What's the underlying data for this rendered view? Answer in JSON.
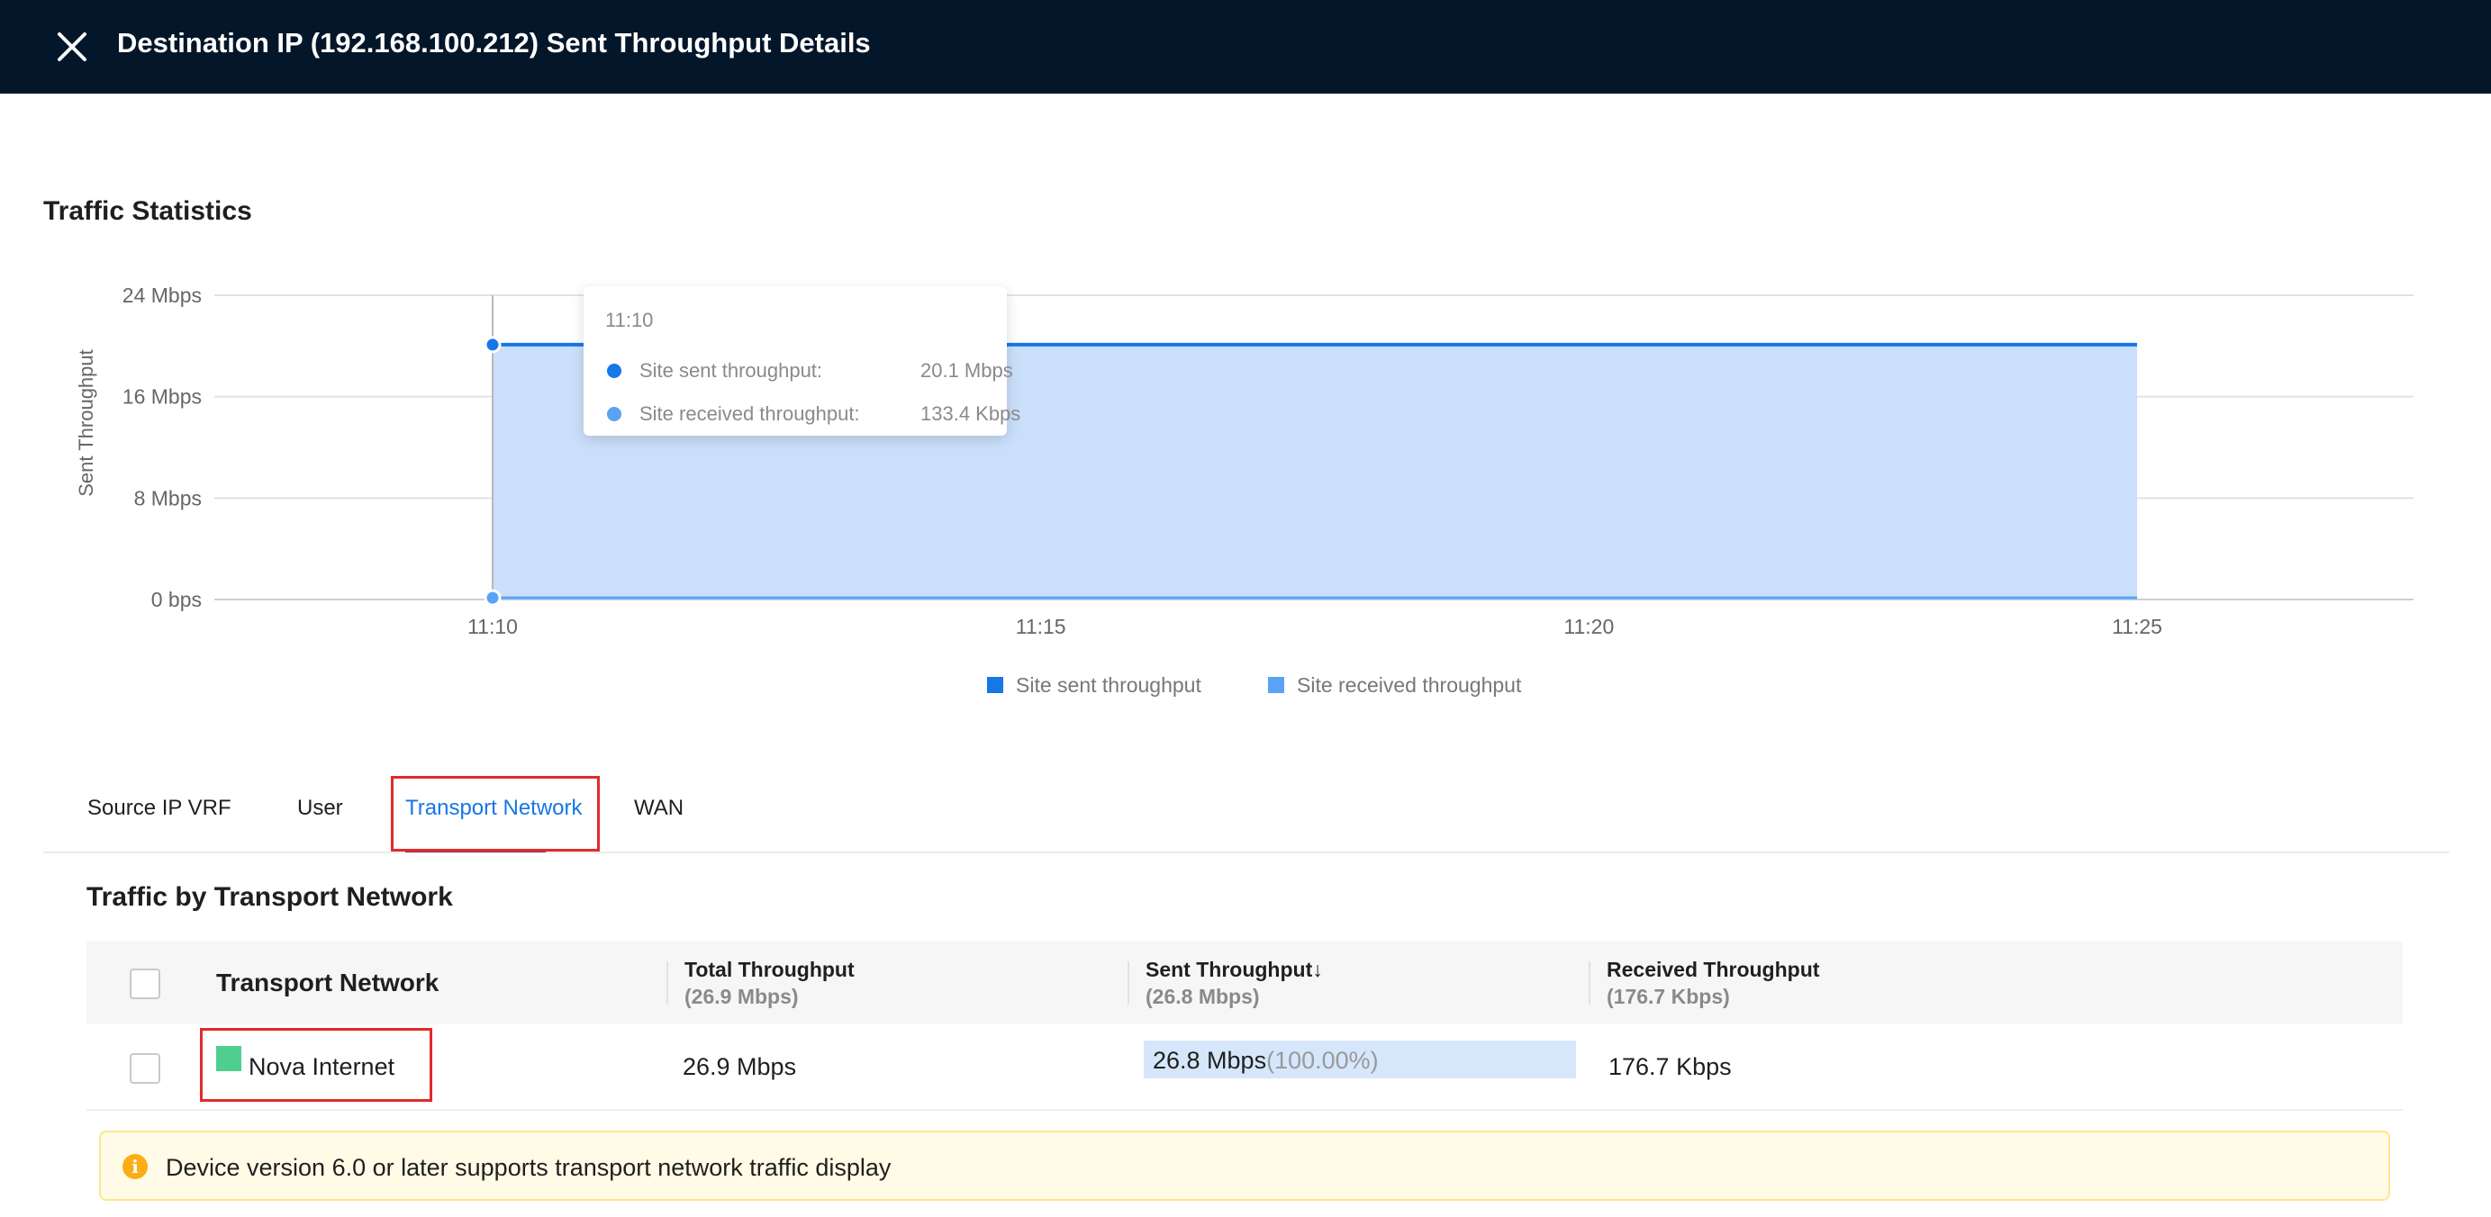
{
  "header": {
    "title": "Destination IP (192.168.100.212) Sent Throughput Details",
    "close_icon": "close-icon"
  },
  "section_title": "Traffic Statistics",
  "chart_data": {
    "type": "area",
    "title": "",
    "xlabel": "",
    "ylabel": "Sent Throughput",
    "x": [
      "11:10",
      "11:25"
    ],
    "x_ticks": [
      "11:10",
      "11:15",
      "11:20",
      "11:25"
    ],
    "y_ticks": [
      "0 bps",
      "8 Mbps",
      "16 Mbps",
      "24 Mbps"
    ],
    "ylim": [
      0,
      24
    ],
    "y_unit": "Mbps",
    "grid": true,
    "legend_position": "bottom-center",
    "series": [
      {
        "name": "Site sent throughput",
        "values": [
          20.1,
          20.1
        ],
        "color": "#1677e6"
      },
      {
        "name": "Site received throughput",
        "values": [
          0.1334,
          0.1334
        ],
        "color": "#59a3f5"
      }
    ]
  },
  "tooltip": {
    "time": "11:10",
    "rows": [
      {
        "label": "Site sent throughput:",
        "value": "20.1 Mbps",
        "color": "#1677e6"
      },
      {
        "label": "Site received throughput:",
        "value": "133.4 Kbps",
        "color": "#59a3f5"
      }
    ]
  },
  "tabs": [
    {
      "label": "Source IP  VRF",
      "active": false
    },
    {
      "label": "User",
      "active": false
    },
    {
      "label": "Transport Network",
      "active": true
    },
    {
      "label": "WAN",
      "active": false
    }
  ],
  "table_title": "Traffic by Transport Network",
  "table": {
    "columns": [
      {
        "label": "Transport Network",
        "sub": ""
      },
      {
        "label": "Total Throughput",
        "sub": "(26.9 Mbps)"
      },
      {
        "label": "Sent Throughput↓",
        "sub": "(26.8 Mbps)"
      },
      {
        "label": "Received Throughput",
        "sub": "(176.7 Kbps)"
      }
    ],
    "rows": [
      {
        "name": "Nova Internet",
        "swatch_color": "#4fcf8e",
        "total": "26.9 Mbps",
        "sent": "26.8 Mbps",
        "sent_pct": "(100.00%)",
        "sent_fraction": 1.0,
        "received": "176.7 Kbps"
      }
    ]
  },
  "notice": {
    "icon": "info-icon",
    "text": "Device version 6.0 or later supports transport network traffic display"
  }
}
